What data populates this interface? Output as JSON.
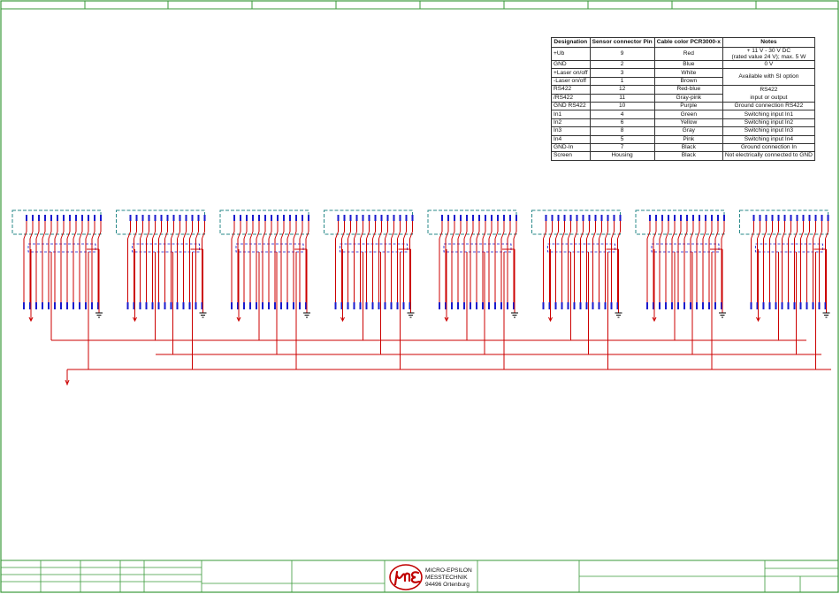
{
  "connection_table": {
    "headers": [
      "Designation",
      "Sensor connector Pin",
      "Cable color PCR3000-x",
      "Notes"
    ],
    "rows": [
      {
        "designation": "+Ub",
        "pin": "9",
        "color": "Red",
        "note": "+ 11 V - 30 V DC",
        "note2": "(rated value 24 V); max. 5 W"
      },
      {
        "designation": "GND",
        "pin": "2",
        "color": "Blue",
        "note": "0 V"
      },
      {
        "designation": "+Laser on/off",
        "pin": "3",
        "color": "White",
        "note": "Available with SI option"
      },
      {
        "designation": "-Laser on/off",
        "pin": "1",
        "color": "Brown"
      },
      {
        "designation": "RS422",
        "pin": "12",
        "color": "Red-blue",
        "note": "RS422"
      },
      {
        "designation": "/RS422",
        "pin": "11",
        "color": "Gray-pink",
        "note": "input or output"
      },
      {
        "designation": "GND RS422",
        "pin": "10",
        "color": "Purple",
        "note": "Ground connection RS422"
      },
      {
        "designation": "In1",
        "pin": "4",
        "color": "Green",
        "note": "Switching input In1"
      },
      {
        "designation": "In2",
        "pin": "6",
        "color": "Yellow",
        "note": "Switching input In2"
      },
      {
        "designation": "In3",
        "pin": "8",
        "color": "Gray",
        "note": "Switching input In3"
      },
      {
        "designation": "In4",
        "pin": "5",
        "color": "Pink",
        "note": "Switching input In4"
      },
      {
        "designation": "GND-In",
        "pin": "7",
        "color": "Black",
        "note": "Ground connection In"
      },
      {
        "designation": "Screen",
        "pin": "Housing",
        "color": "Black",
        "note": "Not electrically connected to GND"
      }
    ]
  },
  "title_block": {
    "company_line1": "MICRO-EPSILON",
    "company_line2": "MESSTECHNIK",
    "company_line3": "94496 Ortenburg"
  },
  "diagram": {
    "sensor_count": 8,
    "wire_color": "#cc0000",
    "pin_color": "#1a1acc",
    "connector_outline_color": "#2a8a8a",
    "frame_color": "#3a9a3a"
  }
}
